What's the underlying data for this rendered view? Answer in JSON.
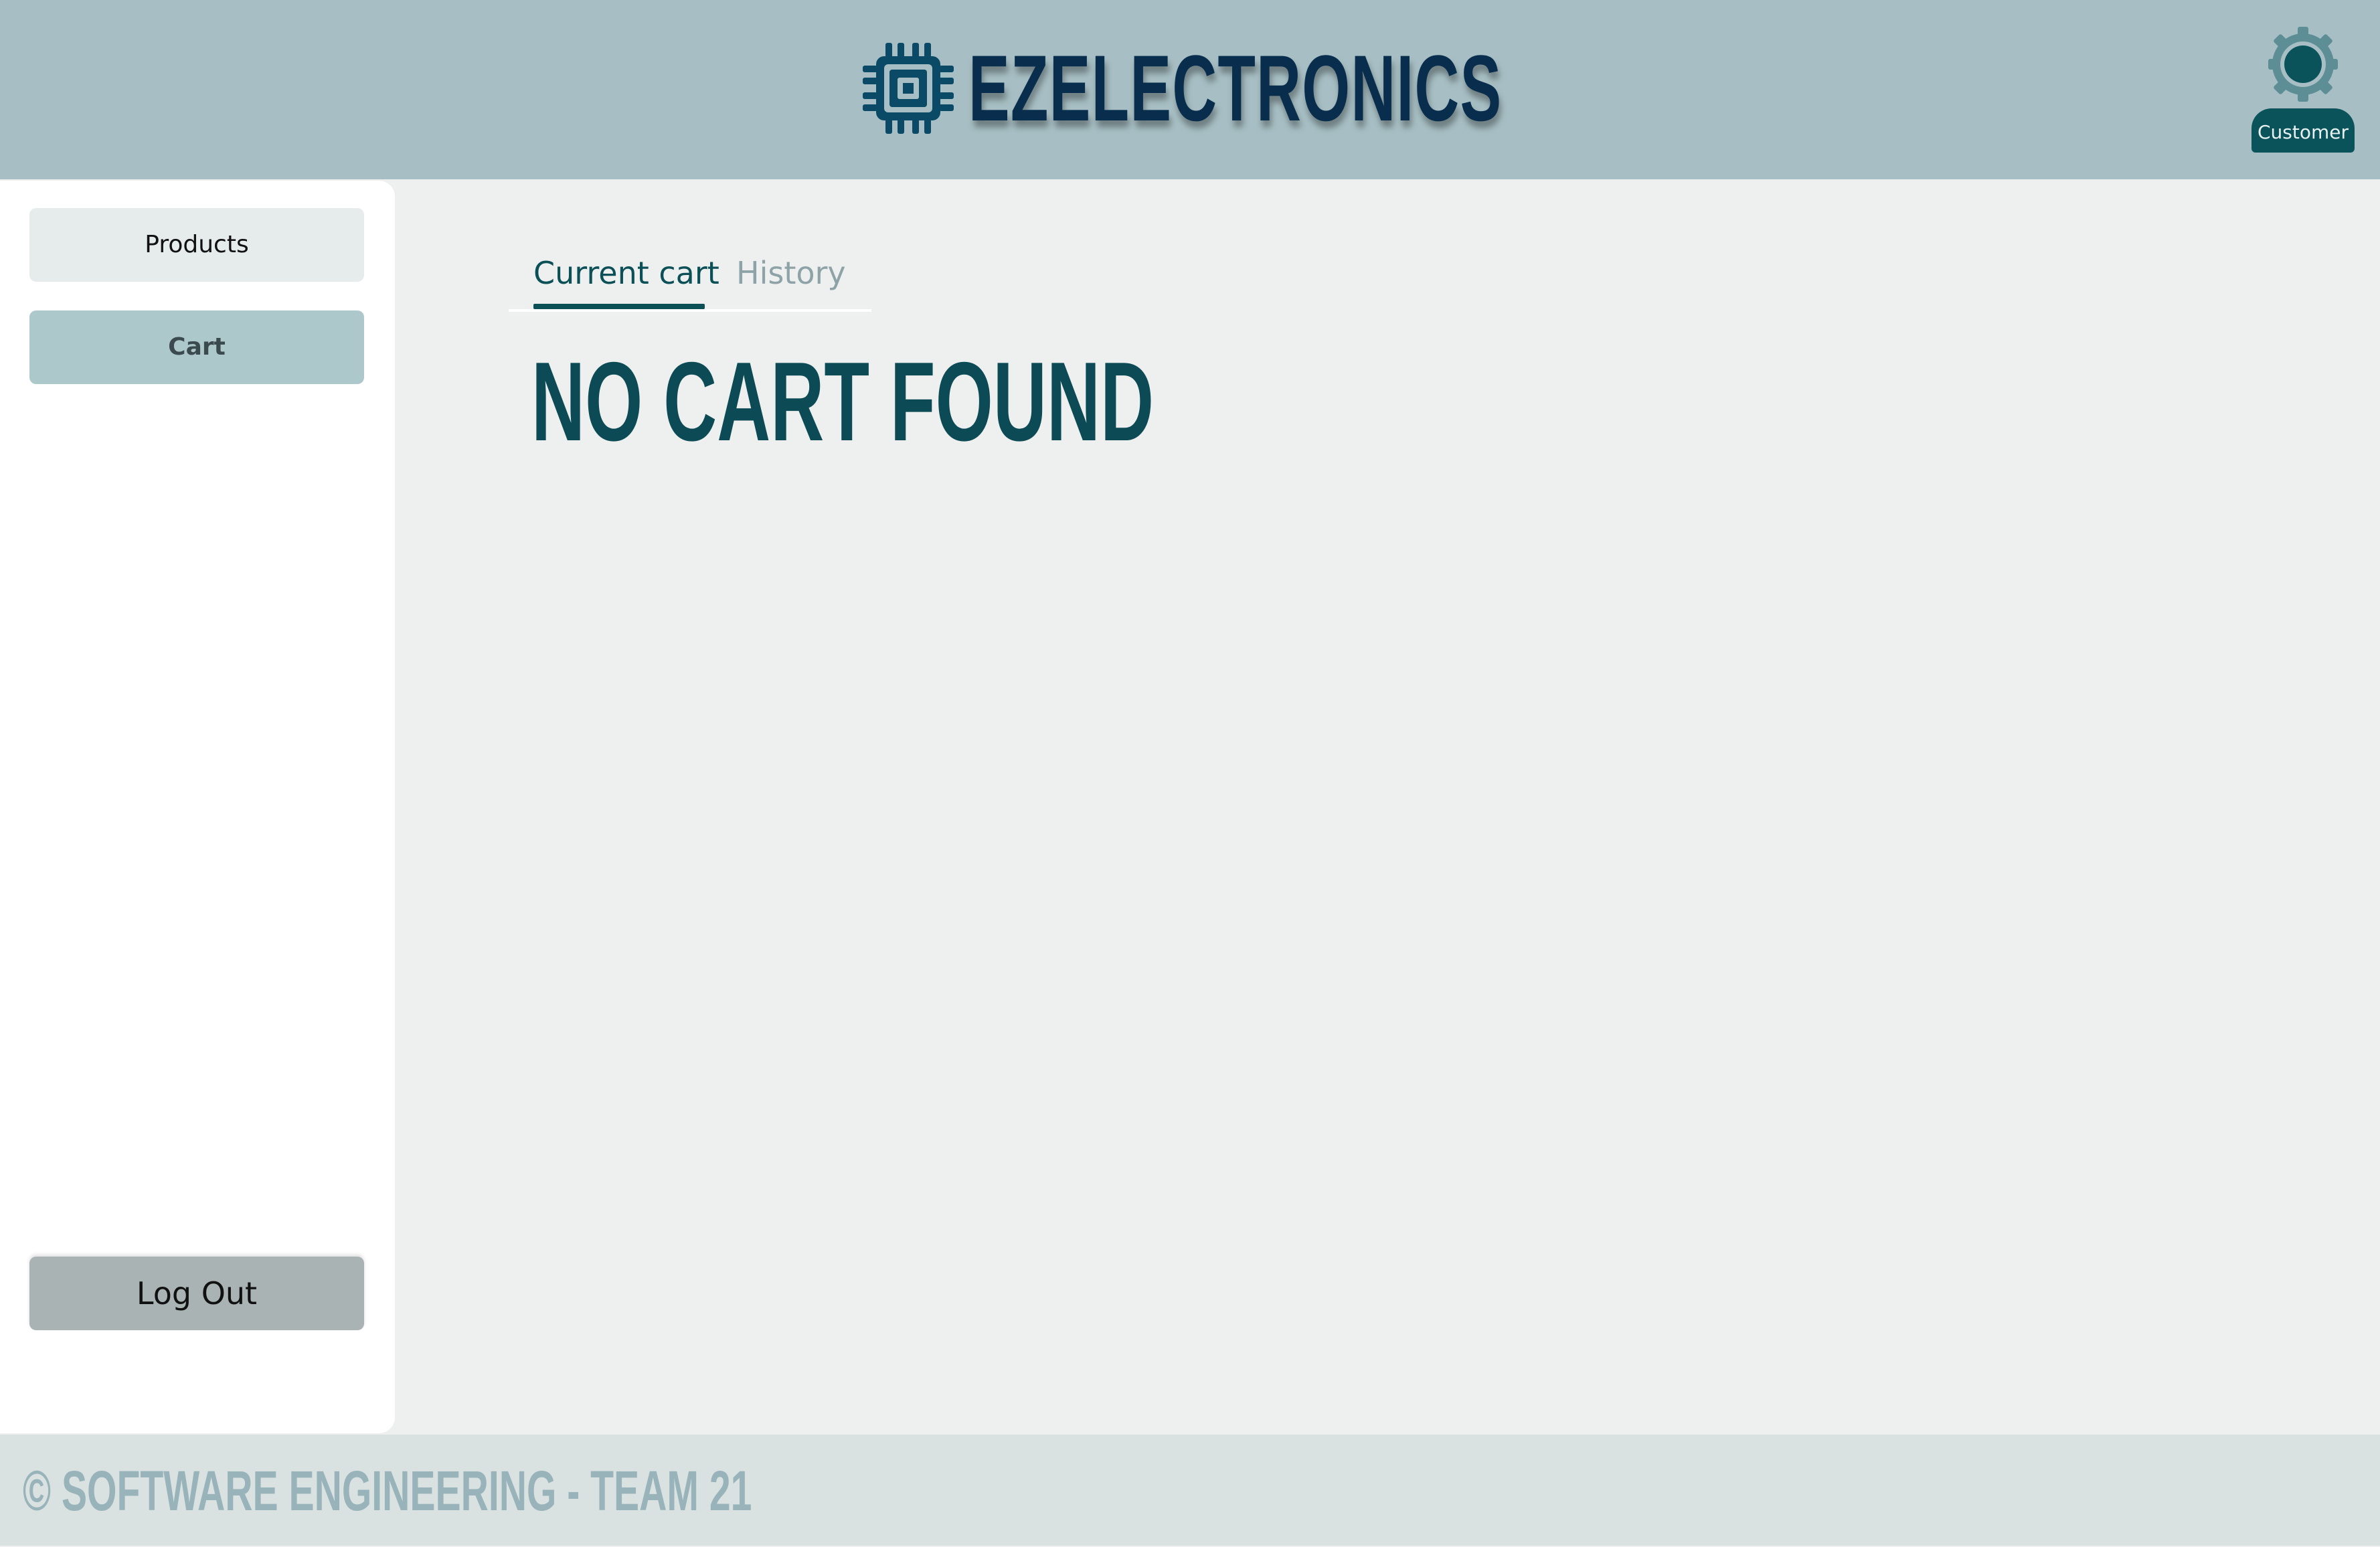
{
  "header": {
    "brand_icon": "chip-icon",
    "brand_name": "EZELECTRONICS",
    "user_icon": "user-gear-icon",
    "user_role": "Customer"
  },
  "sidebar": {
    "items": [
      {
        "label": "Products",
        "active": false
      },
      {
        "label": "Cart",
        "active": true
      }
    ],
    "logout_label": "Log Out"
  },
  "main": {
    "tabs": [
      {
        "label": "Current cart",
        "active": true
      },
      {
        "label": "History",
        "active": false
      }
    ],
    "empty_message": "NO CART FOUND"
  },
  "footer": {
    "text": "© SOFTWARE ENGINEERING - TEAM 21"
  },
  "colors": {
    "header_bg": "#a7bfc4",
    "brand": "#082d4d",
    "accent": "#0b4f57",
    "page_bg": "#eef0ef",
    "footer_text": "#98b4ba"
  }
}
